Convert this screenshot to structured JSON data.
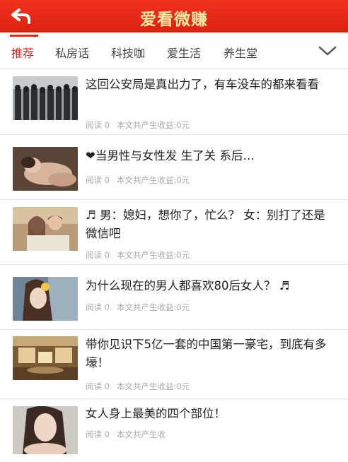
{
  "header": {
    "title": "爱看微赚"
  },
  "tabs": [
    {
      "label": "推荐",
      "active": true
    },
    {
      "label": "私房话"
    },
    {
      "label": "科技咖"
    },
    {
      "label": "爱生活"
    },
    {
      "label": "养生堂"
    }
  ],
  "articles": [
    {
      "title": "这回公安局是真出力了，有车没车的都来看看",
      "read_label": "阅读 0",
      "earnings": "本文共产生收益:0元"
    },
    {
      "title": "❤当男性与女性发 生了关 系后…",
      "read_label": "阅读 0",
      "earnings": "本文共产生收益:0元"
    },
    {
      "title": "♬ 男：媳妇，想你了，忙么？ 女：别打了还是微信吧",
      "read_label": "阅读 0",
      "earnings": "本文共产生收益:0元"
    },
    {
      "title": "为什么现在的男人都喜欢80后女人？ ♬",
      "read_label": "阅读 0",
      "earnings": "本文共产生收益:0元"
    },
    {
      "title": "带你见识下5亿一套的中国第一豪宅，到底有多壕！",
      "read_label": "阅读 0",
      "earnings": "本文共产生收益:0元"
    },
    {
      "title": "女人身上最美的四个部位！",
      "read_label": "阅读 0",
      "earnings": "本文共产生收"
    }
  ],
  "colors": {
    "accent": "#e3251a",
    "header_bg": "#e8281a",
    "header_text": "#fde9a4"
  }
}
